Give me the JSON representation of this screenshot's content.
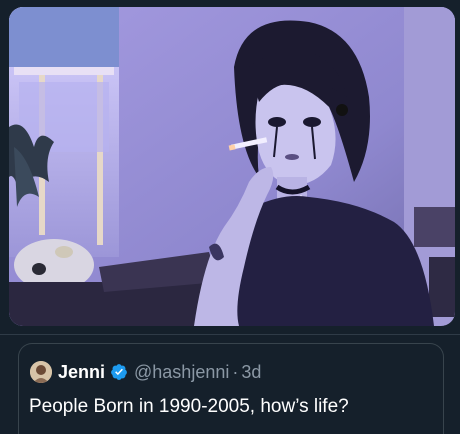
{
  "quoted_tweet": {
    "author_name": "Jenni",
    "handle": "@hashjenni",
    "separator": "·",
    "age": "3d",
    "text": "People Born in 1990-2005, how’s life?"
  },
  "icons": {
    "avatar": "avatar",
    "verified": "verified-badge-icon"
  },
  "colors": {
    "background": "#15202b",
    "text_primary": "#ffffff",
    "text_secondary": "#8b98a5",
    "verified_blue": "#1d9bf0",
    "border": "#38444d"
  }
}
